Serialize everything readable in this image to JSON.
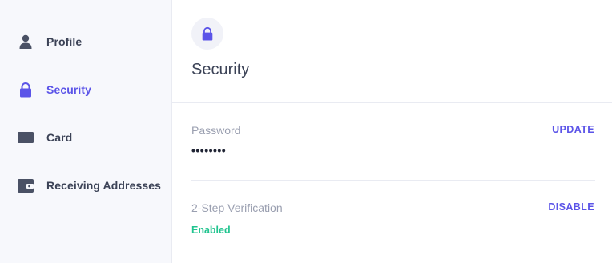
{
  "sidebar": {
    "items": [
      {
        "label": "Profile",
        "icon": "user-icon",
        "active": false
      },
      {
        "label": "Security",
        "icon": "lock-icon",
        "active": true
      },
      {
        "label": "Card",
        "icon": "card-icon",
        "active": false
      },
      {
        "label": "Receiving Addresses",
        "icon": "wallet-icon",
        "active": false
      }
    ]
  },
  "main": {
    "title": "Security",
    "header_icon": "lock-icon",
    "password": {
      "label": "Password",
      "value": "••••••••",
      "action": "UPDATE"
    },
    "two_step": {
      "label": "2-Step Verification",
      "status": "Enabled",
      "action": "DISABLE"
    }
  },
  "colors": {
    "accent": "#5b54e8",
    "text": "#3b4256",
    "muted": "#9a9fb0",
    "success": "#21c48f",
    "sidebar_bg": "#f7f8fc"
  }
}
